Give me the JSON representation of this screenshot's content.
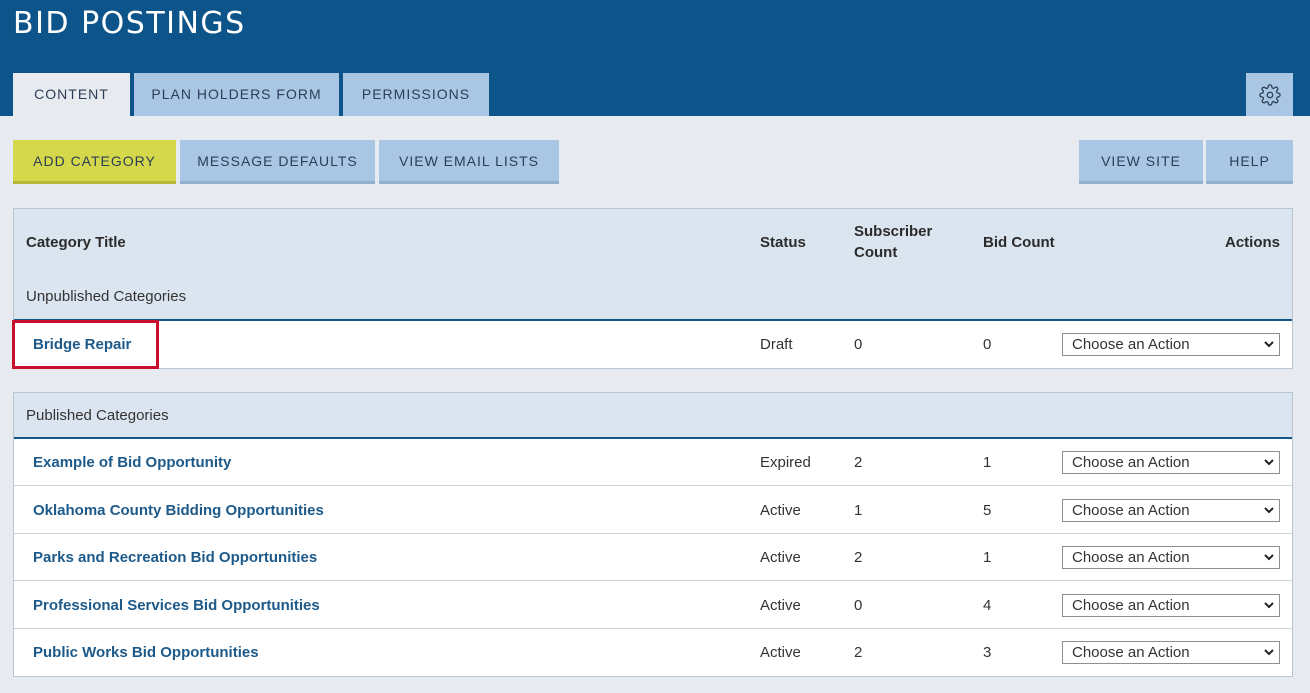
{
  "app": {
    "title": "BID POSTINGS"
  },
  "tabs": [
    {
      "label": "CONTENT"
    },
    {
      "label": "PLAN HOLDERS FORM"
    },
    {
      "label": "PERMISSIONS"
    }
  ],
  "toolbar": {
    "add_category": "ADD CATEGORY",
    "message_defaults": "MESSAGE DEFAULTS",
    "view_email_lists": "VIEW EMAIL LISTS",
    "view_site": "VIEW SITE",
    "help": "HELP"
  },
  "table": {
    "headers": {
      "title": "Category Title",
      "status": "Status",
      "subscriber_line1": "Subscriber",
      "subscriber_line2": "Count",
      "bid_count": "Bid Count",
      "actions": "Actions"
    },
    "unpublished_label": "Unpublished Categories",
    "published_label": "Published Categories",
    "action_placeholder": "Choose an Action",
    "unpublished": [
      {
        "title": "Bridge Repair",
        "status": "Draft",
        "subscribers": "0",
        "bids": "0"
      }
    ],
    "published": [
      {
        "title": "Example of Bid Opportunity",
        "status": "Expired",
        "subscribers": "2",
        "bids": "1"
      },
      {
        "title": "Oklahoma County Bidding Opportunities",
        "status": "Active",
        "subscribers": "1",
        "bids": "5"
      },
      {
        "title": "Parks and Recreation Bid Opportunities",
        "status": "Active",
        "subscribers": "2",
        "bids": "1"
      },
      {
        "title": "Professional Services Bid Opportunities",
        "status": "Active",
        "subscribers": "0",
        "bids": "4"
      },
      {
        "title": "Public Works Bid Opportunities",
        "status": "Active",
        "subscribers": "2",
        "bids": "3"
      }
    ]
  },
  "colors": {
    "header": "#0c5489",
    "tab": "#a9c7e4",
    "primary": "#d4d84a",
    "link": "#1d5a8a",
    "highlight": "#c8102e"
  }
}
